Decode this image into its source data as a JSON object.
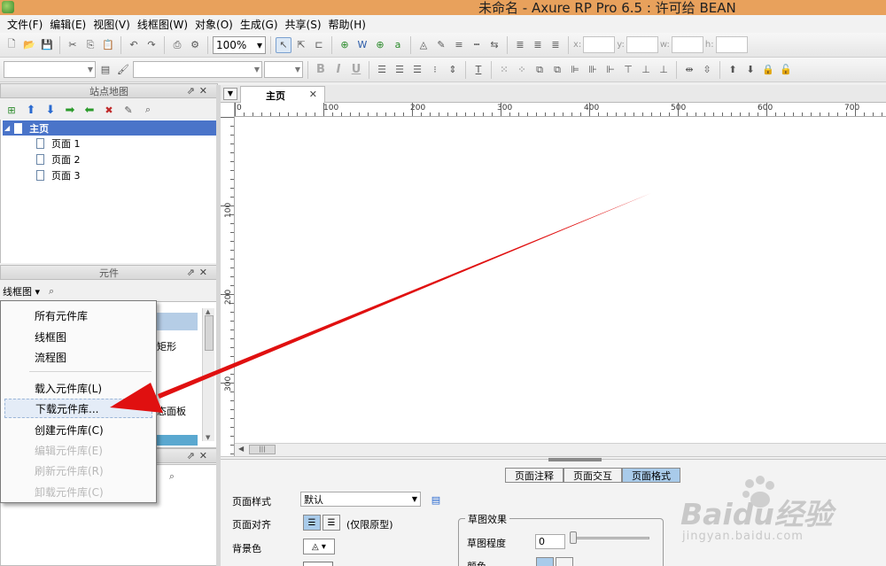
{
  "window": {
    "title": "未命名 - Axure RP Pro 6.5 : 许可给 BEAN"
  },
  "menu": [
    "文件(F)",
    "编辑(E)",
    "视图(V)",
    "线框图(W)",
    "对象(O)",
    "生成(G)",
    "共享(S)",
    "帮助(H)"
  ],
  "toolbar": {
    "zoom": "100%",
    "coord_labels": {
      "x": "x:",
      "y": "y:",
      "w": "w:",
      "h": "h:"
    },
    "format_buttons": [
      "B",
      "I",
      "U"
    ]
  },
  "sitemap": {
    "title": "站点地图",
    "root": "主页",
    "pages": [
      "页面 1",
      "页面 2",
      "页面 3"
    ]
  },
  "widgets": {
    "title": "元件",
    "library_selector": "线框图",
    "partial_labels": [
      "矩形",
      "态面板"
    ]
  },
  "library_menu": {
    "items": [
      {
        "label": "所有元件库",
        "enabled": true
      },
      {
        "label": "线框图",
        "enabled": true
      },
      {
        "label": "流程图",
        "enabled": true
      },
      {
        "label": "载入元件库(L)",
        "enabled": true
      },
      {
        "label": "下载元件库...",
        "enabled": true,
        "highlighted": true
      },
      {
        "label": "创建元件库(C)",
        "enabled": true
      },
      {
        "label": "编辑元件库(E)",
        "enabled": false
      },
      {
        "label": "刷新元件库(R)",
        "enabled": false
      },
      {
        "label": "卸载元件库(C)",
        "enabled": false
      }
    ]
  },
  "canvas": {
    "tab_label": "主页",
    "ruler_h_ticks": [
      "0",
      "100",
      "200",
      "300",
      "400",
      "500",
      "600",
      "700"
    ],
    "ruler_v_ticks": [
      "100",
      "200",
      "300"
    ]
  },
  "page_properties": {
    "tabs": [
      "页面注释",
      "页面交互",
      "页面格式"
    ],
    "active_tab": "页面格式",
    "page_style_label": "页面样式",
    "page_style_value": "默认",
    "page_align_label": "页面对齐",
    "page_align_note": "(仅限原型)",
    "bg_color_label": "背景色",
    "sketch_group_title": "草图效果",
    "sketch_level_label": "草图程度",
    "sketch_level_value": "0",
    "color_label": "颜色"
  },
  "watermark": {
    "logo": "Baidu经验",
    "url": "jingyan.baidu.com"
  },
  "colors": {
    "titlebar": "#e8a15c",
    "selection": "#4a74c9",
    "active_tab": "#a9cbea",
    "annotation_arrow": "#e01010"
  }
}
